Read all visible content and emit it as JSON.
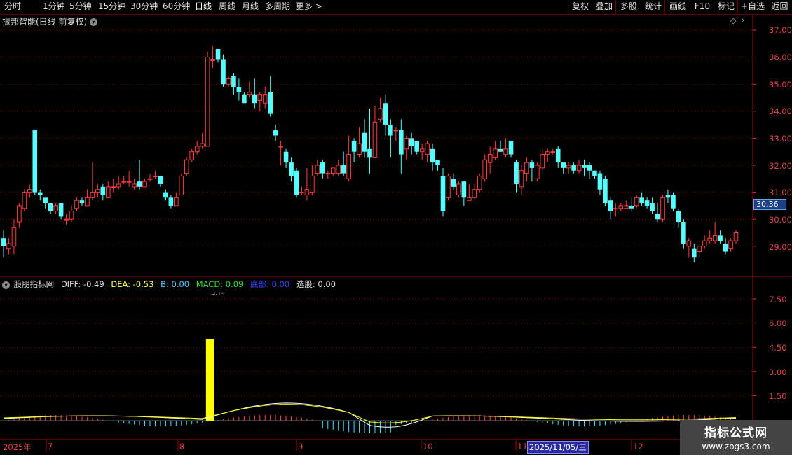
{
  "toolbar": {
    "periods": [
      "分时",
      "1分钟",
      "5分钟",
      "15分钟",
      "30分钟",
      "60分钟",
      "日线",
      "周线",
      "月线",
      "多周期",
      "更多 >"
    ],
    "active_period": "日线",
    "right_buttons": [
      "复权",
      "叠加",
      "多股",
      "统计",
      "画线",
      "F10",
      "标记",
      "+自选",
      "返回"
    ]
  },
  "stock": {
    "title": "振邦智能(日线 前复权)",
    "current_price": "30.36"
  },
  "indicator": {
    "name": "股朋指标网",
    "diff": "DIFF: -0.49",
    "dea": "DEA: -0.53",
    "b": "B: 0.00",
    "macd": "MACD: 0.09",
    "bottom": "底部: 0.00",
    "select": "选股: 0.00",
    "signal_text": "水停"
  },
  "price_axis": [
    "37.00",
    "36.00",
    "35.00",
    "34.00",
    "33.00",
    "32.00",
    "31.00",
    "30.00",
    "29.00"
  ],
  "ind_axis": [
    "7.50",
    "6.00",
    "4.50",
    "3.00",
    "1.50"
  ],
  "date_axis": [
    "2025年",
    "7",
    "8",
    "9",
    "10",
    "11",
    "12"
  ],
  "selected_date": "2025/11/05/三",
  "watermark": {
    "line1": "指标公式网",
    "line2": "www.zbgs3.com"
  },
  "colors": {
    "up": "#ff3b3b",
    "down": "#54ffff",
    "grid": "#8b0000",
    "signal_bar": "#ffff00",
    "diff_line": "#ffffff",
    "dea_line": "#ffff00"
  },
  "candles": [
    [
      29.3,
      29.0,
      29.6,
      28.6
    ],
    [
      28.9,
      29.1,
      29.3,
      28.7
    ],
    [
      29.0,
      29.7,
      30.0,
      28.7
    ],
    [
      29.9,
      30.5,
      30.6,
      29.7
    ],
    [
      30.4,
      31.0,
      31.1,
      30.3
    ],
    [
      31.0,
      31.1,
      31.3,
      30.8
    ],
    [
      33.3,
      31.0,
      33.3,
      30.9
    ],
    [
      31.0,
      30.9,
      31.1,
      30.7
    ],
    [
      30.8,
      30.6,
      30.8,
      30.4
    ],
    [
      30.6,
      30.3,
      30.6,
      30.2
    ],
    [
      30.3,
      30.5,
      30.6,
      30.2
    ],
    [
      30.6,
      30.1,
      30.6,
      30.0
    ],
    [
      30.0,
      30.0,
      30.2,
      29.8
    ],
    [
      30.0,
      30.3,
      30.5,
      29.9
    ],
    [
      30.4,
      30.7,
      30.8,
      30.3
    ],
    [
      30.7,
      30.6,
      30.8,
      30.5
    ],
    [
      30.5,
      30.8,
      31.1,
      30.5
    ],
    [
      30.8,
      31.0,
      32.1,
      30.7
    ],
    [
      31.0,
      31.1,
      31.3,
      30.8
    ],
    [
      31.2,
      30.9,
      31.3,
      30.7
    ],
    [
      30.8,
      31.2,
      31.4,
      30.8
    ],
    [
      31.2,
      31.2,
      31.5,
      31.0
    ],
    [
      31.2,
      31.3,
      31.6,
      31.1
    ],
    [
      31.4,
      31.4,
      31.6,
      31.3
    ],
    [
      31.4,
      31.4,
      31.8,
      31.2
    ],
    [
      31.2,
      31.3,
      31.5,
      31.1
    ],
    [
      31.4,
      31.2,
      32.2,
      31.1
    ],
    [
      31.2,
      31.4,
      31.5,
      31.2
    ],
    [
      31.5,
      31.5,
      31.7,
      31.4
    ],
    [
      31.6,
      31.6,
      31.8,
      31.5
    ],
    [
      31.6,
      31.3,
      31.6,
      31.2
    ],
    [
      31.0,
      30.8,
      31.1,
      30.7
    ],
    [
      30.8,
      30.5,
      30.9,
      30.4
    ],
    [
      30.5,
      30.8,
      31.0,
      30.5
    ],
    [
      30.9,
      31.6,
      31.7,
      30.9
    ],
    [
      31.7,
      32.2,
      32.3,
      31.6
    ],
    [
      32.2,
      32.5,
      32.6,
      32.1
    ],
    [
      32.5,
      32.7,
      32.9,
      32.4
    ],
    [
      32.7,
      32.8,
      33.2,
      32.6
    ],
    [
      32.7,
      36.0,
      36.2,
      32.7
    ],
    [
      35.9,
      35.9,
      36.4,
      35.6
    ],
    [
      36.3,
      35.9,
      36.3,
      35.8
    ],
    [
      35.9,
      35.0,
      36.1,
      34.9
    ],
    [
      35.0,
      35.2,
      35.3,
      34.9
    ],
    [
      35.3,
      34.9,
      35.4,
      34.6
    ],
    [
      34.9,
      34.7,
      35.2,
      34.4
    ],
    [
      34.6,
      34.3,
      34.7,
      34.3
    ],
    [
      34.6,
      34.7,
      35.1,
      34.5
    ],
    [
      34.6,
      34.3,
      35.2,
      34.1
    ],
    [
      34.4,
      34.6,
      34.7,
      34.0
    ],
    [
      34.3,
      34.6,
      34.9,
      34.1
    ],
    [
      34.7,
      33.9,
      35.3,
      33.8
    ],
    [
      33.3,
      33.1,
      33.5,
      32.9
    ],
    [
      32.7,
      32.7,
      32.9,
      32.0
    ],
    [
      32.5,
      32.1,
      32.6,
      31.9
    ],
    [
      32.1,
      31.6,
      32.3,
      31.4
    ],
    [
      31.8,
      30.9,
      31.9,
      30.8
    ],
    [
      31.0,
      31.0,
      31.2,
      30.9
    ],
    [
      30.9,
      31.1,
      31.9,
      30.7
    ],
    [
      31.0,
      31.6,
      32.0,
      30.9
    ],
    [
      31.7,
      32.0,
      32.2,
      31.6
    ],
    [
      32.1,
      31.7,
      32.2,
      31.5
    ],
    [
      31.7,
      31.7,
      31.8,
      31.5
    ],
    [
      31.7,
      31.9,
      31.9,
      31.6
    ],
    [
      31.7,
      32.0,
      32.2,
      31.6
    ],
    [
      32.0,
      31.7,
      32.5,
      31.6
    ],
    [
      31.5,
      32.4,
      33.1,
      31.4
    ],
    [
      32.9,
      32.5,
      33.0,
      32.1
    ],
    [
      32.4,
      32.8,
      33.4,
      32.3
    ],
    [
      33.2,
      32.5,
      33.7,
      32.3
    ],
    [
      32.6,
      32.3,
      34.1,
      31.7
    ],
    [
      32.3,
      33.6,
      34.2,
      32.3
    ],
    [
      33.7,
      34.1,
      34.5,
      33.6
    ],
    [
      34.3,
      33.5,
      34.6,
      33.1
    ],
    [
      33.5,
      33.1,
      33.7,
      32.3
    ],
    [
      33.3,
      33.3,
      33.4,
      32.9
    ],
    [
      33.3,
      32.4,
      33.7,
      31.7
    ],
    [
      32.6,
      33.0,
      33.1,
      32.2
    ],
    [
      33.0,
      32.7,
      33.2,
      32.4
    ],
    [
      32.9,
      32.5,
      32.9,
      32.4
    ],
    [
      32.5,
      32.6,
      32.8,
      32.2
    ],
    [
      32.4,
      32.8,
      32.9,
      32.1
    ],
    [
      32.6,
      32.1,
      32.8,
      31.8
    ],
    [
      32.2,
      32.0,
      32.2,
      31.8
    ],
    [
      31.6,
      30.3,
      31.9,
      30.1
    ],
    [
      30.8,
      31.6,
      31.7,
      30.7
    ],
    [
      31.5,
      31.2,
      31.7,
      31.1
    ],
    [
      30.9,
      31.3,
      31.4,
      30.8
    ],
    [
      31.4,
      30.8,
      31.4,
      30.5
    ],
    [
      30.7,
      30.8,
      31.3,
      30.7
    ],
    [
      30.8,
      31.1,
      31.3,
      30.7
    ],
    [
      31.1,
      31.6,
      31.7,
      31.0
    ],
    [
      31.5,
      32.2,
      32.4,
      31.4
    ],
    [
      32.1,
      32.4,
      32.7,
      31.7
    ],
    [
      32.3,
      32.6,
      32.9,
      32.2
    ],
    [
      32.6,
      32.5,
      32.9,
      32.5
    ],
    [
      32.4,
      32.6,
      33.0,
      32.3
    ],
    [
      32.9,
      32.4,
      32.9,
      32.3
    ],
    [
      32.1,
      31.3,
      32.2,
      31.0
    ],
    [
      31.2,
      31.8,
      32.0,
      30.9
    ],
    [
      31.7,
      32.1,
      32.3,
      31.4
    ],
    [
      32.1,
      31.9,
      32.2,
      31.4
    ],
    [
      31.5,
      32.0,
      32.1,
      31.4
    ],
    [
      31.9,
      32.4,
      32.6,
      31.8
    ],
    [
      32.4,
      32.5,
      32.6,
      32.1
    ],
    [
      32.5,
      32.5,
      32.6,
      32.4
    ],
    [
      32.6,
      32.1,
      32.7,
      31.9
    ],
    [
      32.1,
      31.9,
      32.1,
      31.7
    ],
    [
      31.9,
      32.0,
      32.1,
      31.7
    ],
    [
      32.0,
      31.8,
      32.1,
      31.7
    ],
    [
      31.8,
      32.0,
      32.2,
      31.7
    ],
    [
      32.0,
      31.9,
      32.2,
      31.6
    ],
    [
      32.0,
      31.8,
      32.1,
      31.5
    ],
    [
      31.8,
      31.6,
      31.8,
      31.5
    ],
    [
      31.7,
      31.1,
      31.8,
      30.9
    ],
    [
      31.5,
      30.6,
      31.6,
      30.5
    ],
    [
      30.7,
      30.3,
      30.8,
      30.0
    ],
    [
      30.4,
      30.4,
      30.6,
      30.1
    ],
    [
      30.4,
      30.5,
      30.6,
      30.3
    ],
    [
      30.4,
      30.5,
      30.7,
      30.4
    ],
    [
      30.5,
      30.4,
      30.8,
      30.3
    ],
    [
      30.5,
      30.8,
      30.9,
      30.4
    ],
    [
      30.8,
      30.6,
      31.0,
      30.5
    ],
    [
      30.7,
      30.5,
      30.8,
      30.4
    ],
    [
      30.6,
      30.3,
      30.8,
      30.2
    ],
    [
      30.2,
      30.0,
      30.6,
      29.9
    ],
    [
      30.0,
      30.8,
      30.9,
      29.9
    ],
    [
      30.9,
      30.8,
      31.1,
      30.6
    ],
    [
      30.9,
      30.4,
      31.0,
      30.3
    ],
    [
      30.3,
      29.9,
      30.4,
      29.7
    ],
    [
      29.9,
      29.1,
      30.0,
      28.9
    ],
    [
      29.0,
      29.2,
      29.3,
      28.6
    ],
    [
      28.9,
      28.6,
      29.1,
      28.4
    ],
    [
      28.8,
      29.0,
      29.1,
      28.6
    ],
    [
      29.0,
      29.2,
      29.4,
      28.9
    ],
    [
      29.2,
      29.3,
      29.6,
      29.1
    ],
    [
      29.2,
      29.4,
      29.9,
      29.1
    ],
    [
      29.4,
      29.2,
      29.6,
      29.1
    ],
    [
      29.1,
      28.8,
      29.3,
      28.7
    ],
    [
      28.9,
      29.2,
      29.3,
      28.8
    ],
    [
      29.2,
      29.5,
      29.6,
      29.1
    ]
  ],
  "chart_data": {
    "type": "line",
    "title": "股朋指标网",
    "series": [
      {
        "name": "MACD",
        "values": [
          0.09
        ]
      }
    ],
    "signal_bar": {
      "value": 5.0
    },
    "ylim": [
      0,
      8.5
    ],
    "y_ticks": [
      "7.50",
      "6.00",
      "4.50",
      "3.00",
      "1.50"
    ]
  }
}
